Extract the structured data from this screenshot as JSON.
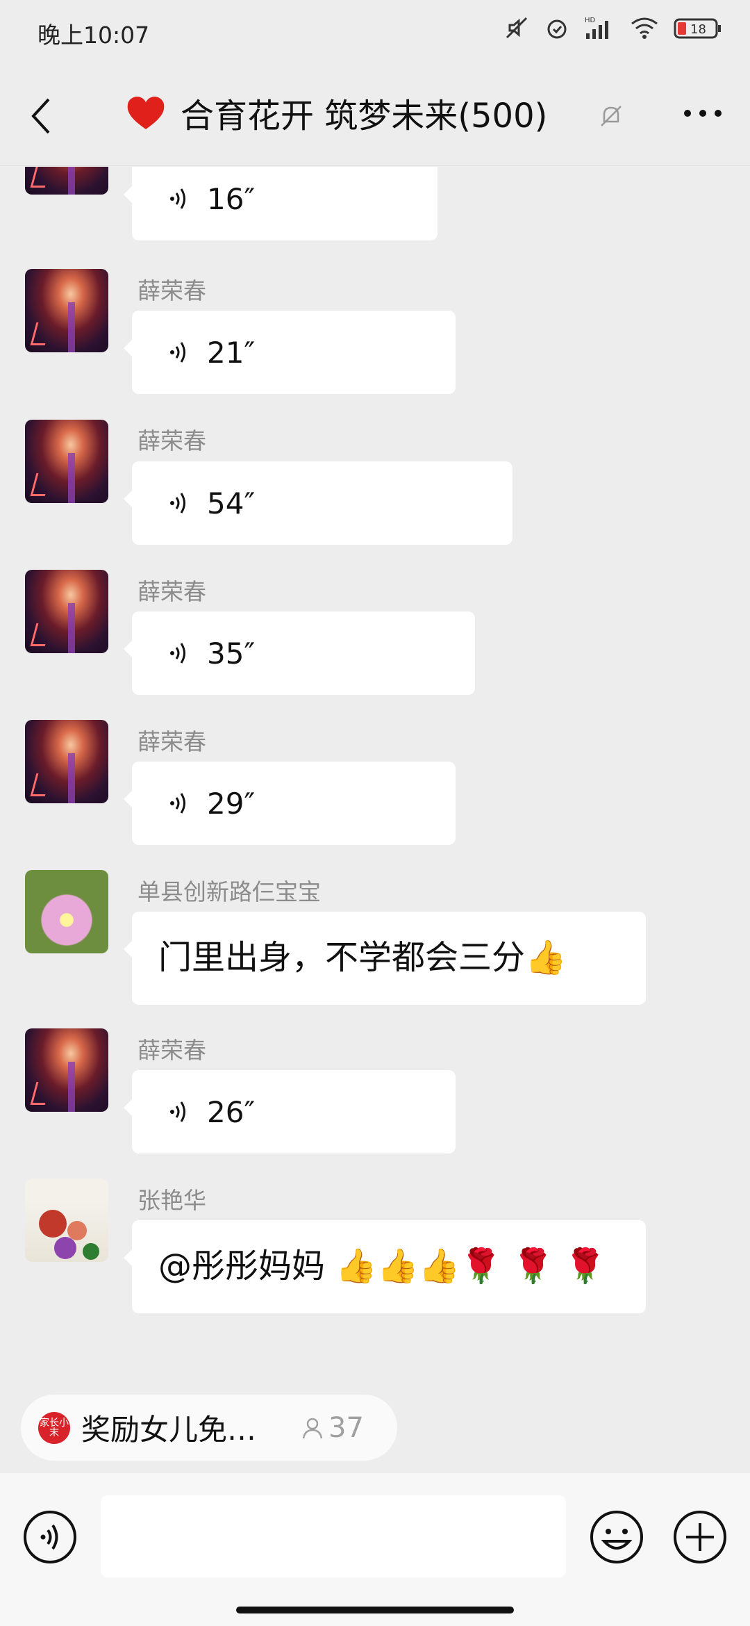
{
  "status_bar": {
    "time": "晚上10:07",
    "battery": "18",
    "network": "HD"
  },
  "header": {
    "title": "合育花开 筑梦未来(500)",
    "back_icon": "chevron-left-icon",
    "mute_icon": "bell-off-icon",
    "more_icon": "more-dots-icon"
  },
  "messages": [
    {
      "type": "voice",
      "sender": "",
      "duration": "16″"
    },
    {
      "type": "voice",
      "sender": "薛荣春",
      "duration": "21″"
    },
    {
      "type": "voice",
      "sender": "薛荣春",
      "duration": "54″"
    },
    {
      "type": "voice",
      "sender": "薛荣春",
      "duration": "35″"
    },
    {
      "type": "voice",
      "sender": "薛荣春",
      "duration": "29″"
    },
    {
      "type": "text",
      "sender": "单县创新路仨宝宝",
      "text": "门里出身，不学都会三分👍"
    },
    {
      "type": "voice",
      "sender": "薛荣春",
      "duration": "26″"
    },
    {
      "type": "text",
      "sender": "张艳华",
      "text": "@彤彤妈妈 👍👍👍🌹 🌹 🌹"
    }
  ],
  "suggestion": {
    "logo_text": "家长小末",
    "text": "奖励女儿免…",
    "count": "37"
  },
  "input_bar": {
    "placeholder": ""
  }
}
